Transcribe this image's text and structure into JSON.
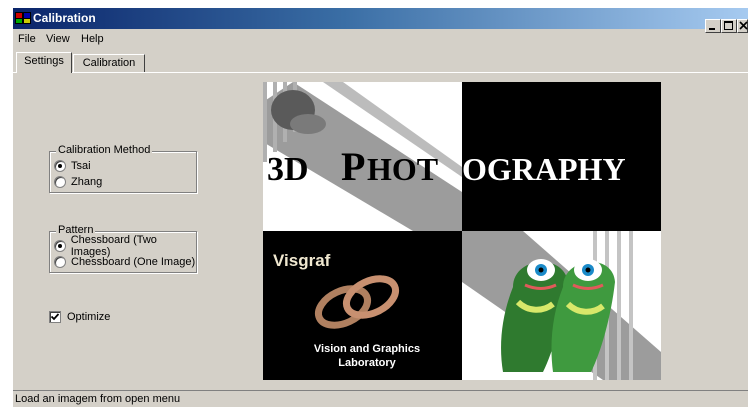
{
  "window": {
    "title": "Calibration"
  },
  "menu": {
    "items": [
      "File",
      "View",
      "Help"
    ]
  },
  "tabs": [
    {
      "label": "Settings",
      "active": true
    },
    {
      "label": "Calibration",
      "active": false
    }
  ],
  "calibration_method": {
    "legend": "Calibration Method",
    "options": [
      {
        "label": "Tsai",
        "selected": true
      },
      {
        "label": "Zhang",
        "selected": false
      }
    ]
  },
  "pattern": {
    "legend": "Pattern",
    "options": [
      {
        "label": "Chessboard (Two Images)",
        "selected": true
      },
      {
        "label": "Chessboard (One Image)",
        "selected": false
      }
    ]
  },
  "optimize": {
    "label": "Optimize",
    "checked": true
  },
  "image": {
    "heading_first_letters": "3D P",
    "heading_part1": "3D ",
    "heading_p": "P",
    "heading_hot": "HOT",
    "heading_ography": "OGRAPHY",
    "lab_name": "Visgraf",
    "lab_line1": "Vision and Graphics",
    "lab_line2": "Laboratory"
  },
  "status": {
    "text": "Load an imagem from open menu"
  },
  "colors": {
    "titlebar_start": "#0a246a",
    "titlebar_end": "#a6caf0",
    "face": "#d4d0c8"
  },
  "icons": {
    "minimize": "minimize-icon",
    "maximize": "maximize-icon",
    "close": "close-icon"
  }
}
